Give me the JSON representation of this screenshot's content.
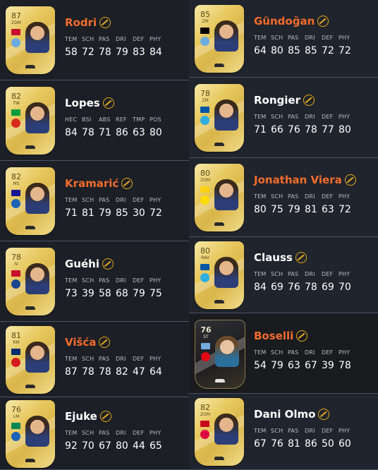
{
  "players": [
    {
      "name": "Rodri",
      "name_color": "orange",
      "rating": "87",
      "position": "ZDM",
      "labels": [
        "TEM",
        "SCH",
        "PAS",
        "DRI",
        "DEF",
        "PHY"
      ],
      "stats": [
        "58",
        "72",
        "78",
        "79",
        "83",
        "84"
      ],
      "card": "gold"
    },
    {
      "name": "Gündoğan",
      "name_color": "orange",
      "rating": "85",
      "position": "ZM",
      "labels": [
        "TEM",
        "SCH",
        "PAS",
        "DRI",
        "DEF",
        "PHY"
      ],
      "stats": [
        "64",
        "80",
        "85",
        "85",
        "72",
        "72"
      ],
      "card": "gold"
    },
    {
      "name": "Lopes",
      "name_color": "white",
      "rating": "82",
      "position": "TW",
      "labels": [
        "HEC",
        "BSI",
        "ABS",
        "REF",
        "TMP",
        "POS"
      ],
      "stats": [
        "84",
        "78",
        "71",
        "86",
        "63",
        "80"
      ],
      "card": "gold"
    },
    {
      "name": "Rongier",
      "name_color": "white",
      "rating": "78",
      "position": "ZM",
      "labels": [
        "TEM",
        "SCH",
        "PAS",
        "DRI",
        "DEF",
        "PHY"
      ],
      "stats": [
        "71",
        "66",
        "76",
        "78",
        "77",
        "80"
      ],
      "card": "gold"
    },
    {
      "name": "Kramarić",
      "name_color": "orange",
      "rating": "82",
      "position": "MS",
      "labels": [
        "TEM",
        "SCH",
        "PAS",
        "DRI",
        "DEF",
        "PHY"
      ],
      "stats": [
        "71",
        "81",
        "79",
        "85",
        "30",
        "72"
      ],
      "card": "gold"
    },
    {
      "name": "Jonathan Viera",
      "name_color": "orange",
      "rating": "80",
      "position": "ZOM",
      "labels": [
        "TEM",
        "SCH",
        "PAS",
        "DRI",
        "DEF",
        "PHY"
      ],
      "stats": [
        "80",
        "75",
        "79",
        "81",
        "63",
        "72"
      ],
      "card": "gold"
    },
    {
      "name": "Guéhi",
      "name_color": "white",
      "rating": "78",
      "position": "IV",
      "labels": [
        "TEM",
        "SCH",
        "PAS",
        "DRI",
        "DEF",
        "PHY"
      ],
      "stats": [
        "73",
        "39",
        "58",
        "68",
        "79",
        "75"
      ],
      "card": "gold"
    },
    {
      "name": "Clauss",
      "name_color": "white",
      "rating": "80",
      "position": "RAV",
      "labels": [
        "TEM",
        "SCH",
        "PAS",
        "DRI",
        "DEF",
        "PHY"
      ],
      "stats": [
        "84",
        "69",
        "76",
        "78",
        "69",
        "70"
      ],
      "card": "gold"
    },
    {
      "name": "Višća",
      "name_color": "orange",
      "rating": "81",
      "position": "RM",
      "labels": [
        "TEM",
        "SCH",
        "PAS",
        "DRI",
        "DEF",
        "PHY"
      ],
      "stats": [
        "87",
        "78",
        "78",
        "82",
        "47",
        "64"
      ],
      "card": "gold"
    },
    {
      "name": "Boselli",
      "name_color": "orange",
      "rating": "76",
      "position": "ST",
      "labels": [
        "TEM",
        "SCH",
        "PAS",
        "DRI",
        "DEF",
        "PHY"
      ],
      "stats": [
        "54",
        "79",
        "63",
        "67",
        "39",
        "78"
      ],
      "card": "dark"
    },
    {
      "name": "Ejuke",
      "name_color": "white",
      "rating": "76",
      "position": "LM",
      "labels": [
        "TEM",
        "SCH",
        "PAS",
        "DRI",
        "DEF",
        "PHY"
      ],
      "stats": [
        "92",
        "70",
        "67",
        "80",
        "44",
        "65"
      ],
      "card": "gold"
    },
    {
      "name": "Dani Olmo",
      "name_color": "white",
      "rating": "82",
      "position": "ZOM",
      "labels": [
        "TEM",
        "SCH",
        "PAS",
        "DRI",
        "DEF",
        "PHY"
      ],
      "stats": [
        "67",
        "76",
        "81",
        "86",
        "50",
        "60"
      ],
      "card": "gold"
    }
  ],
  "colors": {
    "accent_orange": "#f36c2c",
    "chem_icon": "#e3a91c",
    "background": "#1c1f26"
  },
  "icons": {
    "chemistry": "chemistry-icon",
    "boot": "boot-icon"
  }
}
